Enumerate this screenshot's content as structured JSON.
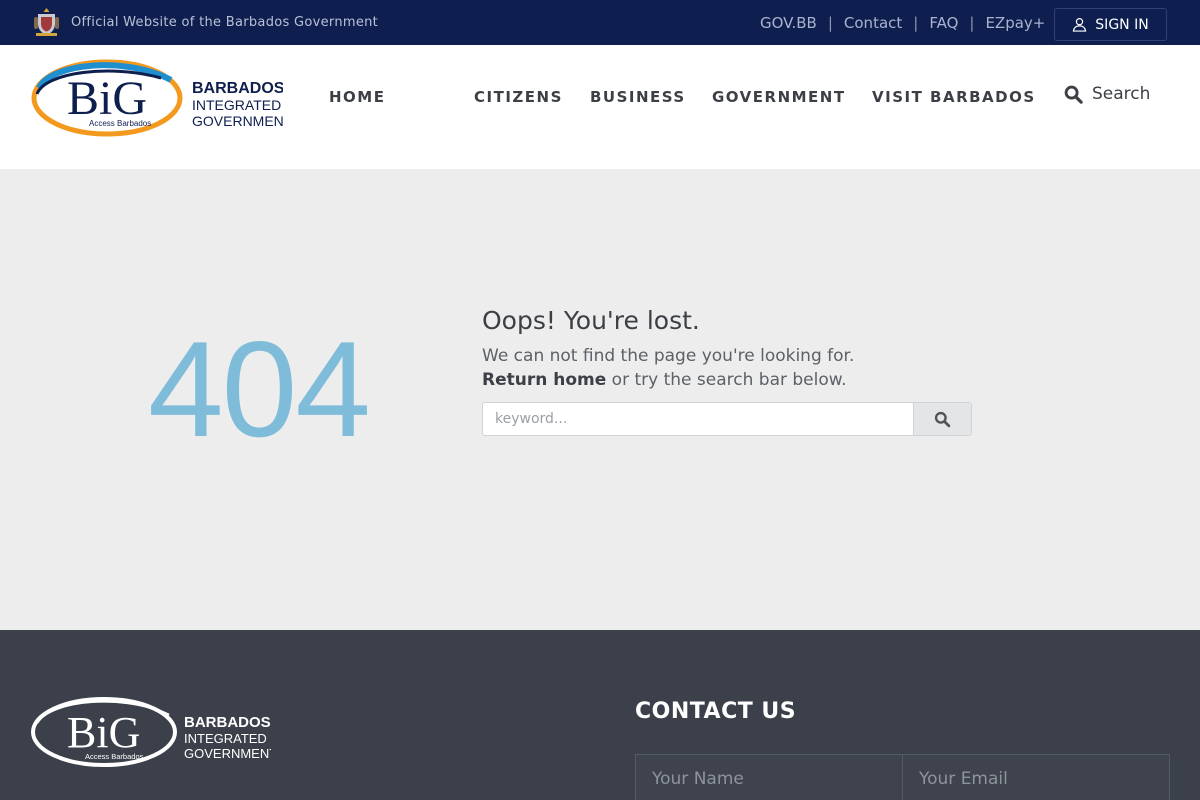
{
  "topbar": {
    "official_text": "Official Website of the Barbados Government",
    "links": [
      "GOV.BB",
      "Contact",
      "FAQ",
      "EZpay+"
    ],
    "separator": "|",
    "sign_in": "SIGN IN"
  },
  "logo": {
    "mark": "BiG",
    "tagline": "Access Barbados",
    "line1": "BARBADOS",
    "line2": "INTEGRATED",
    "line3": "GOVERNMENT"
  },
  "nav": {
    "items": [
      "HOME",
      "CITIZENS",
      "BUSINESS",
      "GOVERNMENT",
      "VISIT BARBADOS"
    ],
    "search_label": "Search"
  },
  "error": {
    "code": "404",
    "heading": "Oops! You're lost.",
    "message": "We can not find the page you're looking for.",
    "return_link": "Return home",
    "return_suffix": " or try the search bar below.",
    "search_placeholder": "keyword..."
  },
  "footer": {
    "contact_title": "CONTACT US",
    "name_placeholder": "Your Name",
    "email_placeholder": "Your Email"
  },
  "colors": {
    "topbar_bg": "#0e1f4f",
    "accent_404": "#7fbcd9",
    "logo_orange": "#f39a1e",
    "logo_blue": "#1f8fd0",
    "footer_bg": "#3b404a"
  }
}
